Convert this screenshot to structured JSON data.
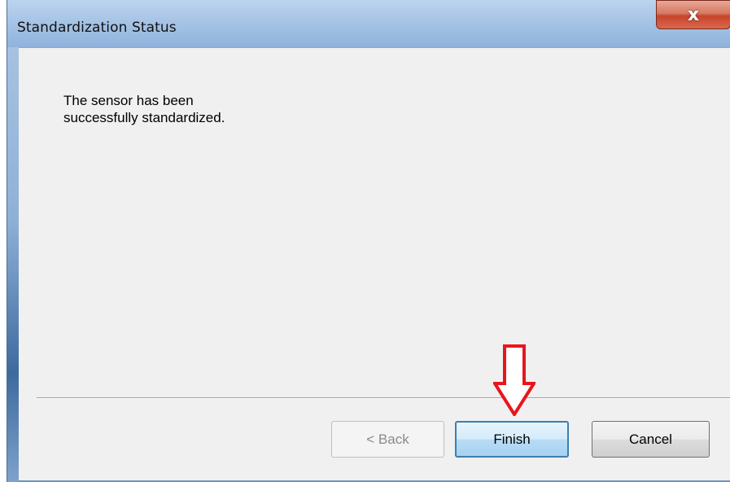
{
  "window": {
    "title": "Standardization Status",
    "close_glyph": "x"
  },
  "content": {
    "message_line1": "The sensor has been",
    "message_line2": "successfully standardized."
  },
  "buttons": {
    "back_label": "< Back",
    "finish_label": "Finish",
    "cancel_label": "Cancel"
  },
  "annotation": {
    "arrow_icon": "down-arrow-icon",
    "arrow_color": "#e8161c"
  },
  "colors": {
    "titlebar": "#a9c6e7",
    "close_button": "#c8432c",
    "client_background": "#f0f0f0",
    "default_button_border": "#3c7fb1"
  }
}
